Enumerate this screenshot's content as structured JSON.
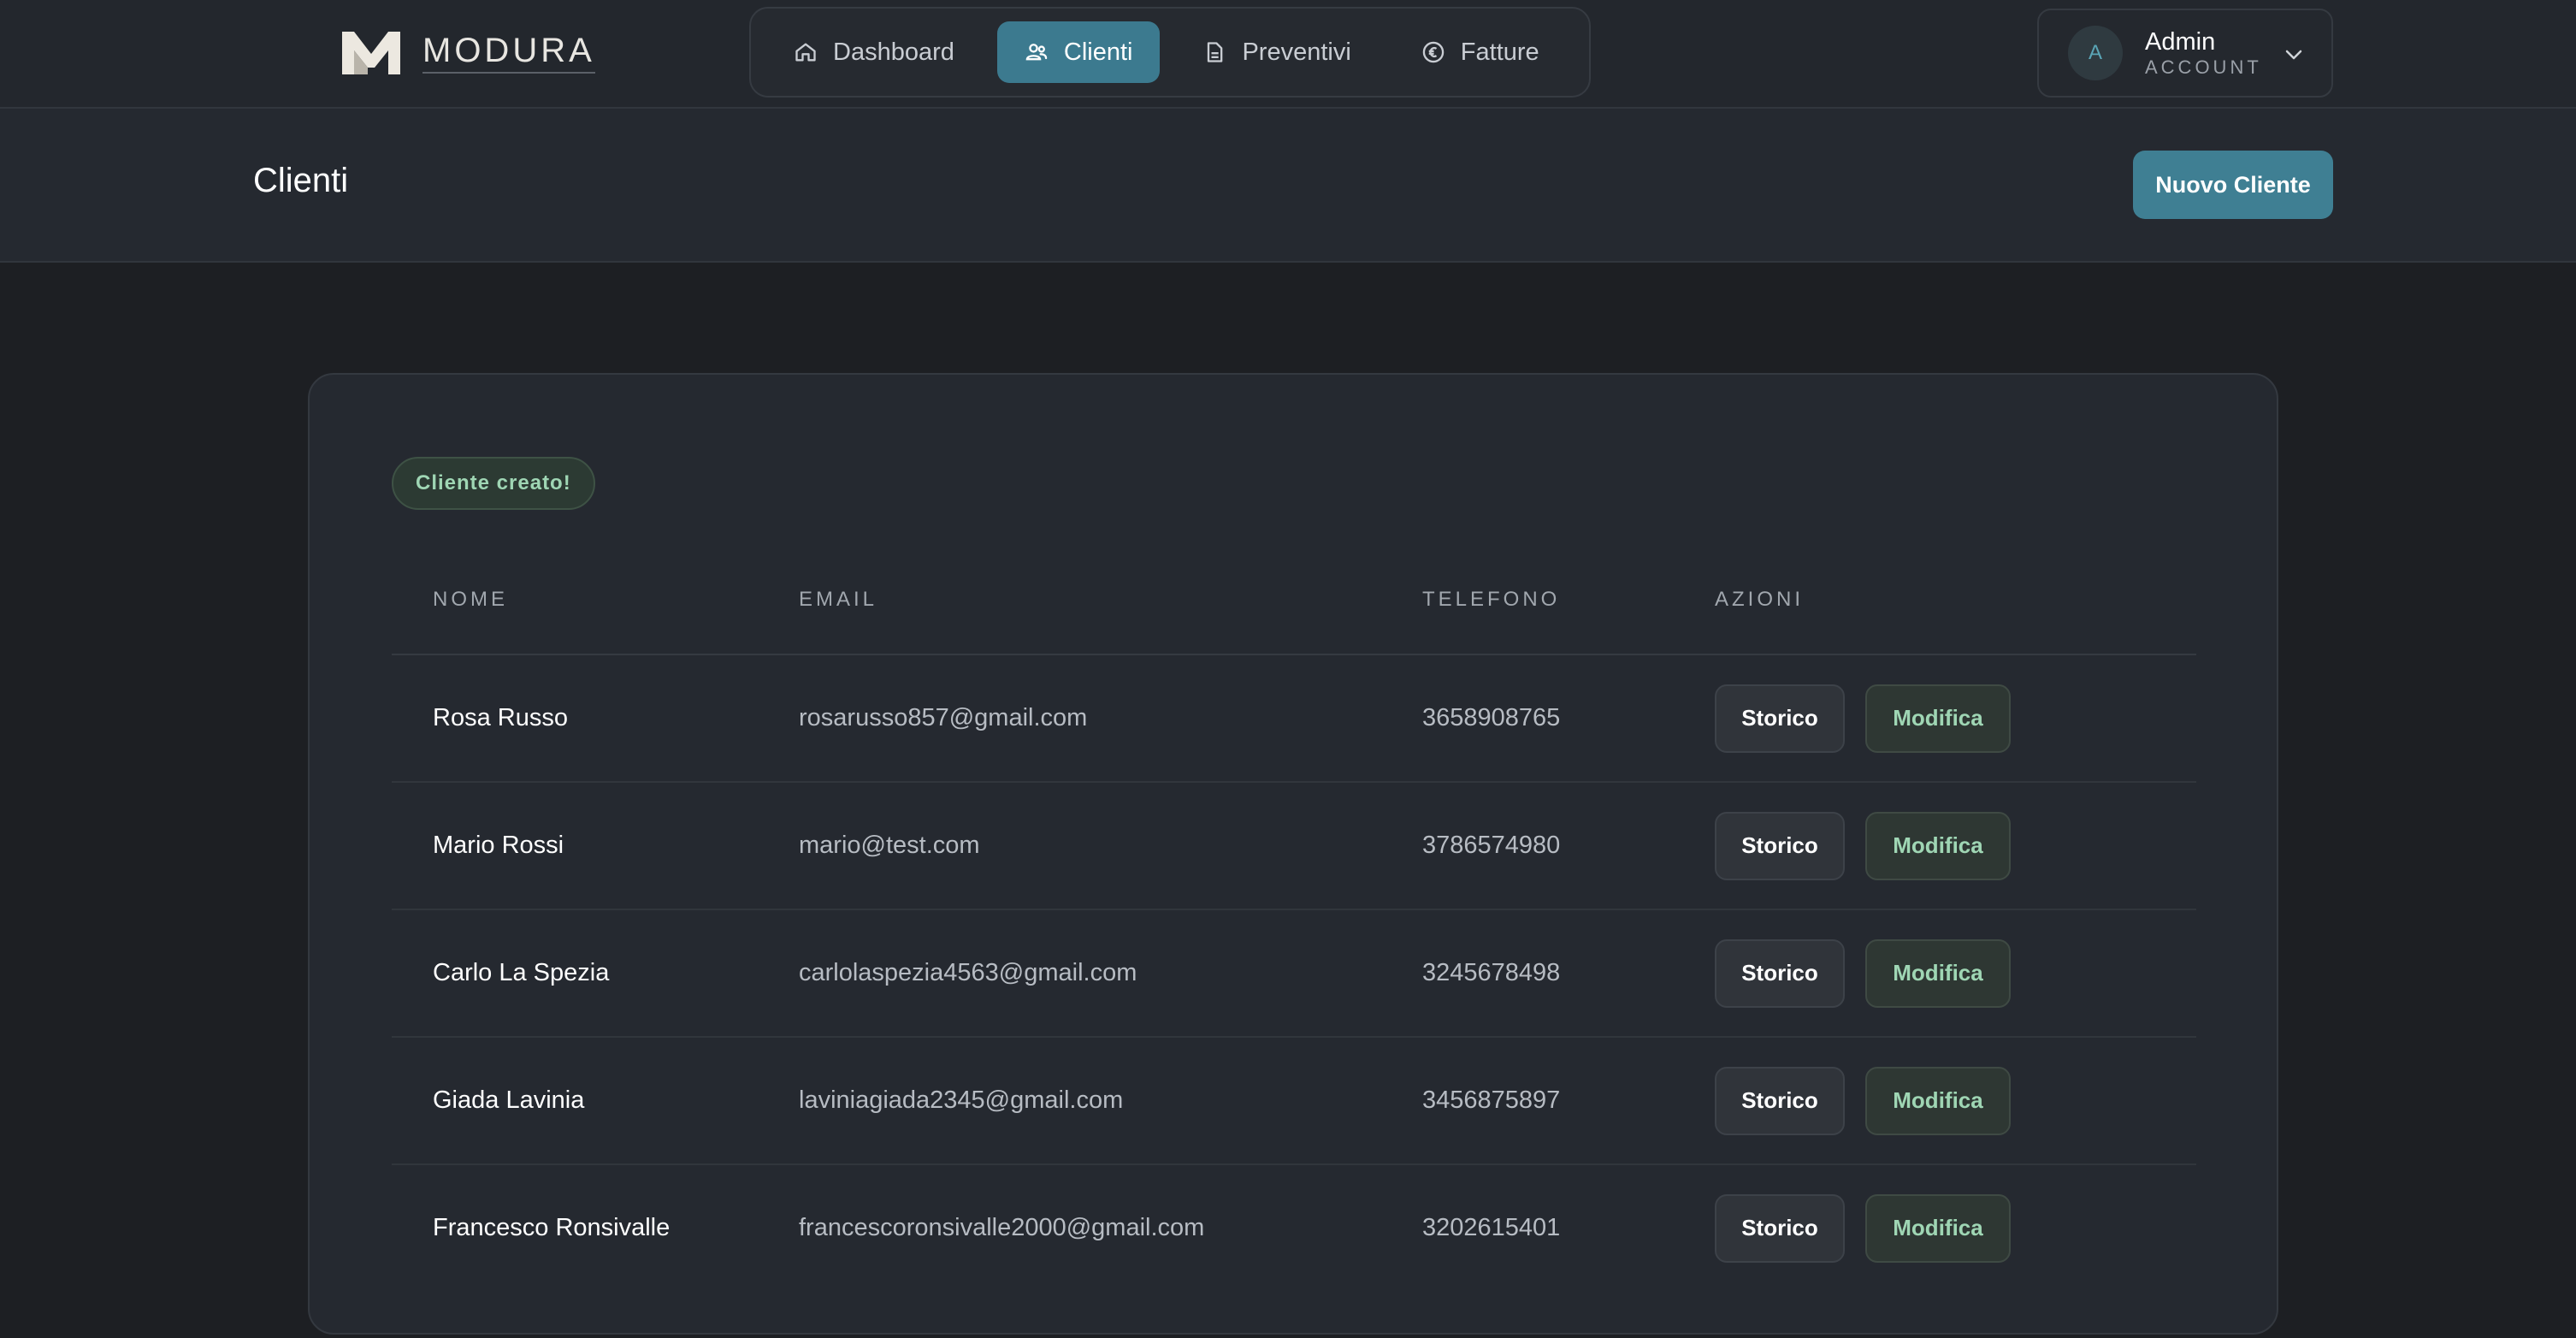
{
  "brand": {
    "name": "MODURA"
  },
  "nav": {
    "items": [
      {
        "label": "Dashboard",
        "icon": "home-icon",
        "active": false
      },
      {
        "label": "Clienti",
        "icon": "users-icon",
        "active": true
      },
      {
        "label": "Preventivi",
        "icon": "document-icon",
        "active": false
      },
      {
        "label": "Fatture",
        "icon": "euro-icon",
        "active": false
      }
    ]
  },
  "account": {
    "initial": "A",
    "name": "Admin",
    "role": "ACCOUNT"
  },
  "header": {
    "title": "Clienti",
    "new_button": "Nuovo Cliente"
  },
  "flash": {
    "message": "Cliente creato!"
  },
  "table": {
    "columns": [
      "NOME",
      "EMAIL",
      "TELEFONO",
      "AZIONI"
    ],
    "rows": [
      {
        "nome": "Rosa Russo",
        "email": "rosarusso857@gmail.com",
        "telefono": "3658908765"
      },
      {
        "nome": "Mario Rossi",
        "email": "mario@test.com",
        "telefono": "3786574980"
      },
      {
        "nome": "Carlo La Spezia",
        "email": "carlolaspezia4563@gmail.com",
        "telefono": "3245678498"
      },
      {
        "nome": "Giada Lavinia",
        "email": "laviniagiada2345@gmail.com",
        "telefono": "3456875897"
      },
      {
        "nome": "Francesco Ronsivalle",
        "email": "francescoronsivalle2000@gmail.com",
        "telefono": "3202615401"
      }
    ],
    "actions": {
      "history": "Storico",
      "edit": "Modifica"
    }
  },
  "colors": {
    "accent": "#3f7f93",
    "success": "#9fd6b4",
    "background": "#1d1f23"
  }
}
